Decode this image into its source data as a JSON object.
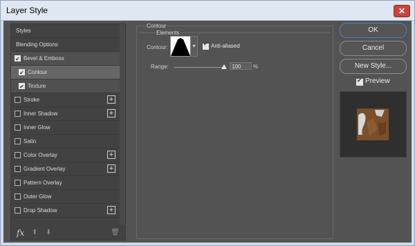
{
  "window": {
    "title": "Layer Style",
    "close_label": "✕"
  },
  "left_panel": {
    "items": [
      {
        "label": "Styles"
      },
      {
        "label": "Blending Options"
      },
      {
        "label": "Bevel & Emboss",
        "checked": true
      },
      {
        "label": "Contour",
        "checked": true,
        "selected": true
      },
      {
        "label": "Texture",
        "checked": true
      },
      {
        "label": "Stroke",
        "checked": false,
        "plus": "+"
      },
      {
        "label": "Inner Shadow",
        "checked": false,
        "plus": "+"
      },
      {
        "label": "Inner Glow",
        "checked": false
      },
      {
        "label": "Satin",
        "checked": false
      },
      {
        "label": "Color Overlay",
        "checked": false,
        "plus": "+"
      },
      {
        "label": "Gradient Overlay",
        "checked": false,
        "plus": "+"
      },
      {
        "label": "Pattern Overlay",
        "checked": false
      },
      {
        "label": "Outer Glow",
        "checked": false
      },
      {
        "label": "Drop Shadow",
        "checked": false,
        "plus": "+"
      }
    ],
    "bottom": {
      "fx": "fx",
      "up": "⬆",
      "down": "⬇",
      "trash": "🗑"
    }
  },
  "contour_panel": {
    "title": "Contour",
    "elements_title": "Elements",
    "contour_label": "Contour:",
    "anti_aliased_label": "Anti-aliased",
    "anti_aliased": true,
    "range_label": "Range:",
    "range_value": "100",
    "range_unit": "%"
  },
  "buttons": {
    "ok": "OK",
    "cancel": "Cancel",
    "new_style": "New Style..."
  },
  "preview": {
    "label": "Preview",
    "checked": true
  }
}
